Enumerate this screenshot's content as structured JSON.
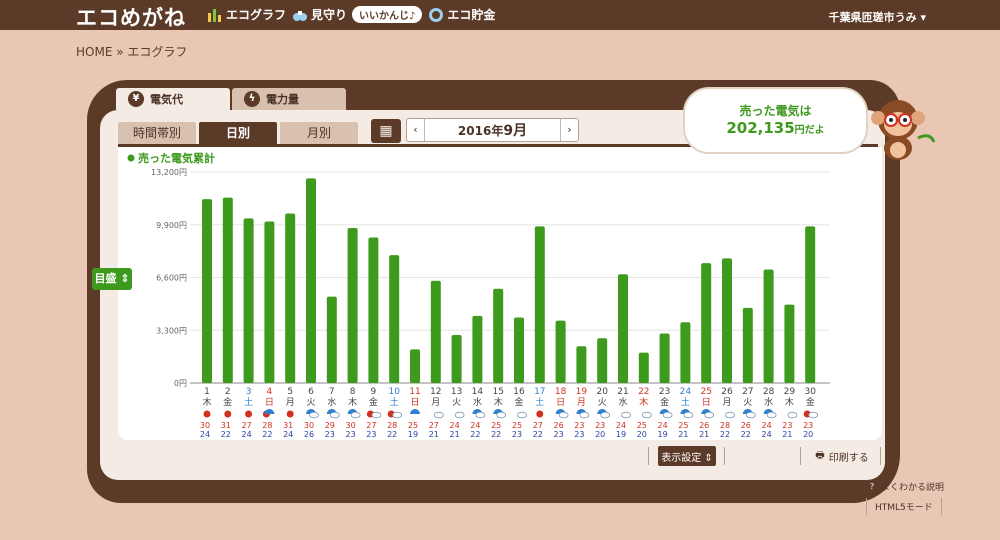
{
  "app": {
    "logo": "エコめがね",
    "user": "千葉県匝瑳市うみ ▾"
  },
  "nav": [
    {
      "icon": "bar-chart-icon",
      "label": "エコグラフ"
    },
    {
      "icon": "binoculars-icon",
      "label": "見守り"
    },
    {
      "icon": "speech-bubble",
      "label": "いいかんじ♪"
    },
    {
      "icon": "coin-icon",
      "label": "エコ貯金"
    }
  ],
  "breadcrumb": "HOME » エコグラフ",
  "tabs": {
    "main": [
      "電気代",
      "電力量"
    ],
    "sub": [
      "時間帯別",
      "日別",
      "月別"
    ]
  },
  "date": {
    "prev": "‹",
    "next": "›",
    "year": "2016年",
    "month": "9月"
  },
  "sold": {
    "line1": "売った電気は",
    "amount": "202,135",
    "suffix": "円だよ"
  },
  "scale_button": "目盛 ⇕",
  "buttons": {
    "display": "表示設定 ⇕",
    "print": "印刷する",
    "help": "よくわかる説明",
    "html5": "HTML5モード"
  },
  "colors": {
    "bar": "#3d9a1c",
    "sat": "#2e7fcf",
    "sun": "#d0301e",
    "frame": "#5c3a28"
  },
  "chart_data": {
    "type": "bar",
    "legend": "売った電気累計",
    "yticks": [
      "13,200円",
      "9,900円",
      "6,600円",
      "3,300円",
      "0円"
    ],
    "ylim": [
      0,
      13200
    ],
    "categories": [
      "1",
      "2",
      "3",
      "4",
      "5",
      "6",
      "7",
      "8",
      "9",
      "10",
      "11",
      "12",
      "13",
      "14",
      "15",
      "16",
      "17",
      "18",
      "19",
      "20",
      "21",
      "22",
      "23",
      "24",
      "25",
      "26",
      "27",
      "28",
      "29",
      "30"
    ],
    "weekdays": [
      "木",
      "金",
      "土",
      "日",
      "月",
      "火",
      "水",
      "木",
      "金",
      "土",
      "日",
      "月",
      "火",
      "水",
      "木",
      "金",
      "土",
      "日",
      "月",
      "火",
      "水",
      "木",
      "金",
      "土",
      "日",
      "月",
      "火",
      "水",
      "木",
      "金"
    ],
    "day_types": [
      "w",
      "w",
      "sat",
      "sun",
      "w",
      "w",
      "w",
      "w",
      "w",
      "sat",
      "sun",
      "w",
      "w",
      "w",
      "w",
      "w",
      "sat",
      "sun",
      "hol",
      "w",
      "w",
      "hol",
      "w",
      "sat",
      "sun",
      "w",
      "w",
      "w",
      "w",
      "w"
    ],
    "values": [
      11500,
      11600,
      10300,
      10100,
      10600,
      12800,
      5400,
      9700,
      9100,
      8000,
      2100,
      6400,
      3000,
      4200,
      5900,
      4100,
      9800,
      3900,
      2300,
      2800,
      6800,
      1900,
      3100,
      3800,
      7500,
      7800,
      4700,
      7100,
      4900,
      9800
    ],
    "weather": [
      "sun",
      "sun",
      "sun",
      "sun-umb",
      "sun",
      "umb-cloud",
      "umb-cloud",
      "umb-cloud",
      "sun-cloud",
      "sun-cloud",
      "umb",
      "cloud",
      "cloud",
      "umb-cloud",
      "umb-cloud",
      "cloud",
      "sun",
      "umb-cloud",
      "umb-cloud",
      "umb-cloud",
      "cloud",
      "cloud",
      "umb-cloud",
      "umb-cloud",
      "umb-cloud",
      "cloud",
      "umb-cloud",
      "umb-cloud",
      "cloud",
      "sun-cloud"
    ],
    "high": [
      "30",
      "31",
      "27",
      "28",
      "31",
      "30",
      "29",
      "30",
      "27",
      "28",
      "25",
      "27",
      "24",
      "24",
      "25",
      "25",
      "27",
      "26",
      "23",
      "23",
      "24",
      "25",
      "24",
      "25",
      "26",
      "28",
      "26",
      "24",
      "23",
      "23"
    ],
    "low": [
      "24",
      "22",
      "24",
      "22",
      "24",
      "26",
      "23",
      "23",
      "23",
      "22",
      "19",
      "21",
      "21",
      "22",
      "22",
      "23",
      "22",
      "23",
      "23",
      "20",
      "19",
      "20",
      "19",
      "21",
      "21",
      "22",
      "22",
      "24",
      "21",
      "20"
    ]
  }
}
